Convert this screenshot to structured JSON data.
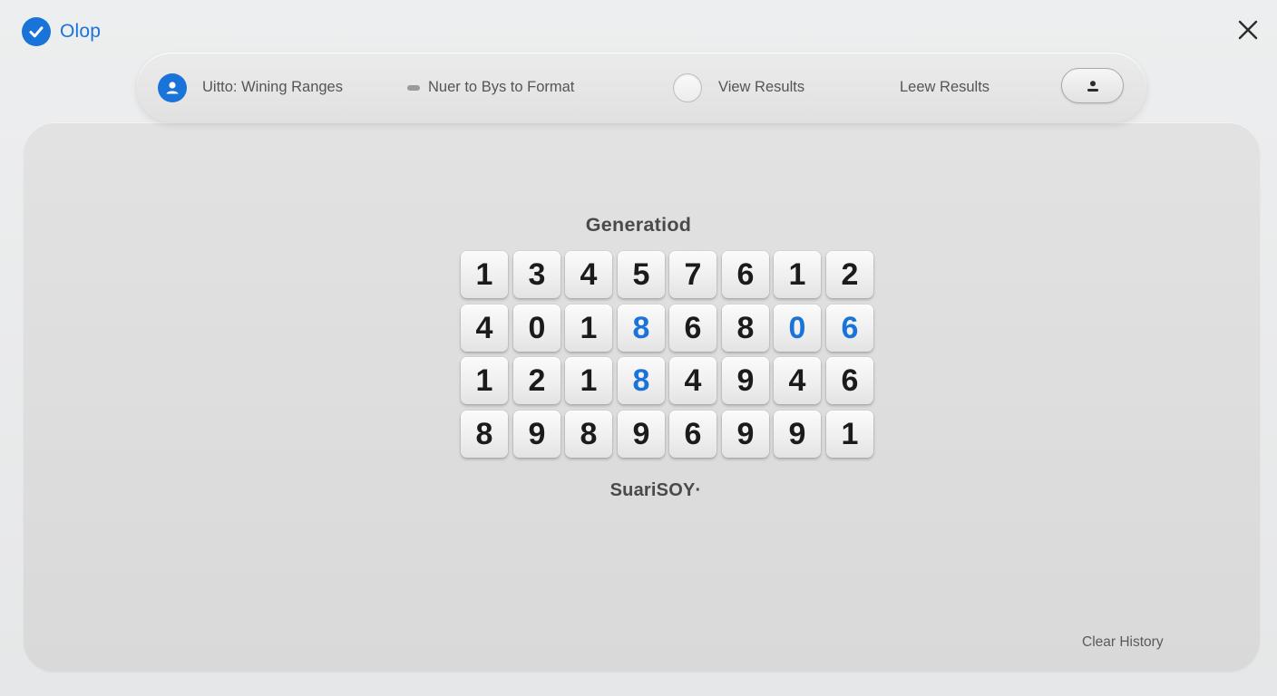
{
  "app": {
    "name": "Olop"
  },
  "toolbar": {
    "user_label": "Uitto: Wining Ranges",
    "format_label": "Nuer to Bys to Format",
    "view_label": "View Results",
    "leew_label": "Leew Results"
  },
  "main": {
    "heading": "Generatiod",
    "subheading": "SuariSOY·",
    "grid": {
      "rows": [
        [
          "1",
          "3",
          "4",
          "5",
          "7",
          "6",
          "1",
          "2"
        ],
        [
          "4",
          "0",
          "1",
          "8",
          "6",
          "8",
          "0",
          "6"
        ],
        [
          "1",
          "2",
          "1",
          "8",
          "4",
          "9",
          "4",
          "6"
        ],
        [
          "8",
          "9",
          "8",
          "9",
          "6",
          "9",
          "9",
          "1"
        ]
      ],
      "highlighted": [
        [
          1,
          3
        ],
        [
          1,
          6
        ],
        [
          1,
          7
        ],
        [
          2,
          3
        ]
      ],
      "highlight_color": "#1a73d9"
    },
    "clear_history_label": "Clear History"
  },
  "colors": {
    "accent": "#1a73d9"
  },
  "icons": {
    "brand": "check-circle-icon",
    "close": "close-icon",
    "user": "user-circle-icon",
    "format": "pill-icon",
    "account": "person-icon"
  }
}
